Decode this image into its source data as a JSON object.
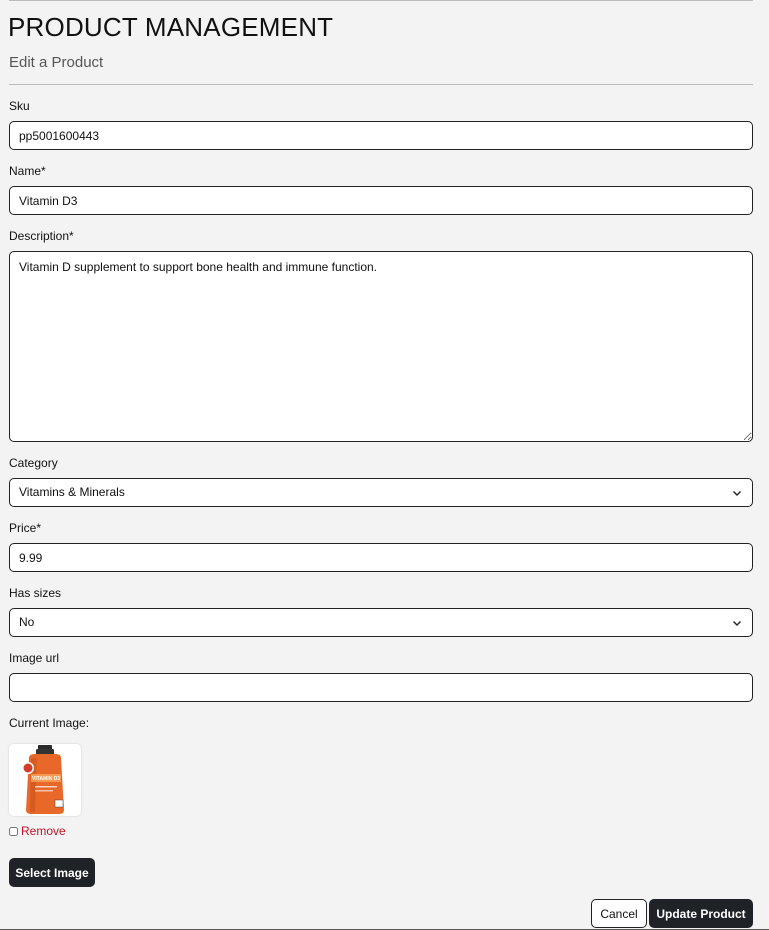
{
  "header": {
    "title": "PRODUCT MANAGEMENT",
    "subtitle": "Edit a Product"
  },
  "form": {
    "sku": {
      "label": "Sku",
      "value": "pp5001600443"
    },
    "name": {
      "label": "Name*",
      "value": "Vitamin D3"
    },
    "description": {
      "label": "Description*",
      "value": "Vitamin D supplement to support bone health and immune function."
    },
    "category": {
      "label": "Category",
      "selected": "Vitamins & Minerals"
    },
    "price": {
      "label": "Price*",
      "value": "9.99"
    },
    "has_sizes": {
      "label": "Has sizes",
      "selected": "No"
    },
    "image_url": {
      "label": "Image url",
      "value": ""
    },
    "current_image": {
      "label": "Current Image:",
      "product_text": "VITAMIN D3"
    },
    "remove": {
      "label": "Remove",
      "checked": false
    }
  },
  "buttons": {
    "select_image": "Select Image",
    "cancel": "Cancel",
    "update": "Update Product"
  },
  "colors": {
    "background": "#f3f3f3",
    "dark_button": "#1f2226",
    "remove_link": "#c0132b",
    "bottle_orange": "#e8682a"
  }
}
